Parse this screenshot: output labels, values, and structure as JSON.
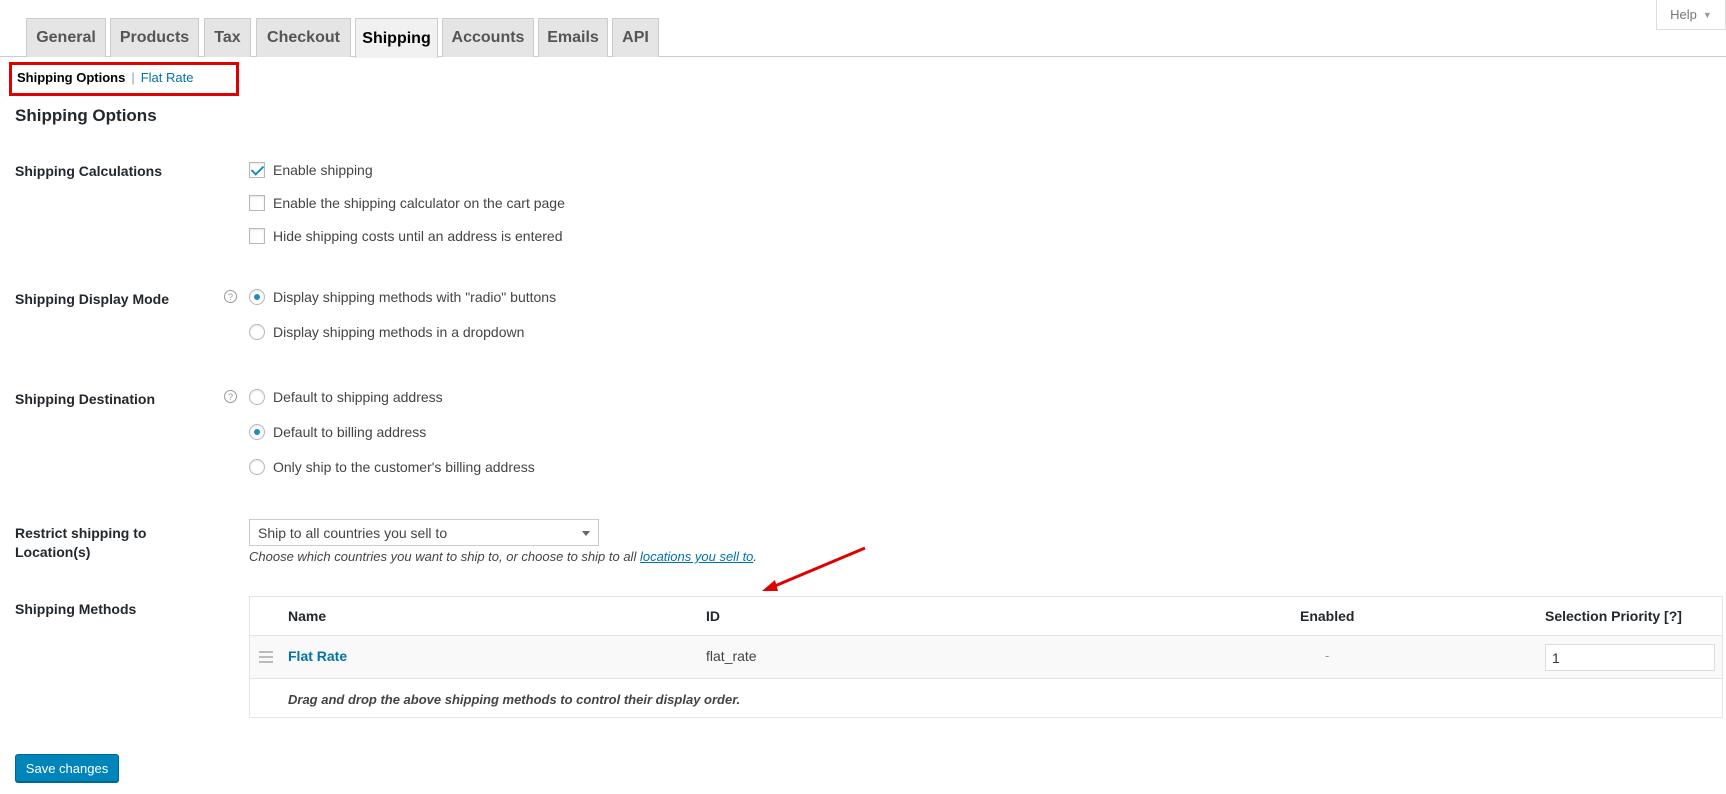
{
  "help": {
    "label": "Help"
  },
  "tabs": [
    {
      "label": "General"
    },
    {
      "label": "Products"
    },
    {
      "label": "Tax"
    },
    {
      "label": "Checkout"
    },
    {
      "label": "Shipping",
      "active": true
    },
    {
      "label": "Accounts"
    },
    {
      "label": "Emails"
    },
    {
      "label": "API"
    }
  ],
  "subnav": {
    "current": "Shipping Options",
    "separator": "|",
    "link": "Flat Rate"
  },
  "page_title": "Shipping Options",
  "calculations": {
    "label": "Shipping Calculations",
    "options": [
      {
        "label": "Enable shipping",
        "checked": true
      },
      {
        "label": "Enable the shipping calculator on the cart page",
        "checked": false
      },
      {
        "label": "Hide shipping costs until an address is entered",
        "checked": false
      }
    ]
  },
  "display_mode": {
    "label": "Shipping Display Mode",
    "tip": "?",
    "options": [
      {
        "label": "Display shipping methods with \"radio\" buttons",
        "checked": true
      },
      {
        "label": "Display shipping methods in a dropdown",
        "checked": false
      }
    ]
  },
  "destination": {
    "label": "Shipping Destination",
    "tip": "?",
    "options": [
      {
        "label": "Default to shipping address",
        "checked": false
      },
      {
        "label": "Default to billing address",
        "checked": true
      },
      {
        "label": "Only ship to the customer's billing address",
        "checked": false
      }
    ]
  },
  "restrict": {
    "label_line1": "Restrict shipping to",
    "label_line2": "Location(s)",
    "selected": "Ship to all countries you sell to",
    "desc_prefix": "Choose which countries you want to ship to, or choose to ship to all ",
    "desc_link": "locations you sell to",
    "desc_suffix": "."
  },
  "methods": {
    "label": "Shipping Methods",
    "headers": {
      "name": "Name",
      "id": "ID",
      "enabled": "Enabled",
      "priority": "Selection Priority [?]"
    },
    "rows": [
      {
        "name": "Flat Rate",
        "id": "flat_rate",
        "enabled": "-",
        "priority": "1"
      }
    ],
    "footer": "Drag and drop the above shipping methods to control their display order."
  },
  "save": {
    "label": "Save changes"
  },
  "colors": {
    "accent": "#0073aa",
    "button": "#0085ba",
    "annotation": "#e00000"
  }
}
